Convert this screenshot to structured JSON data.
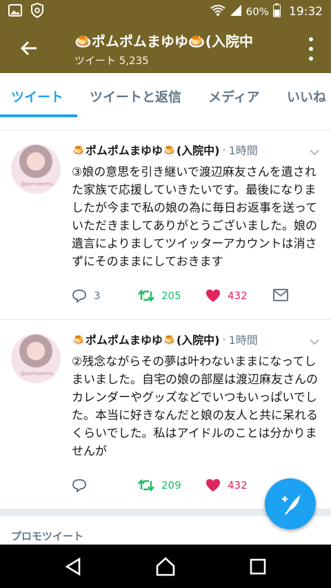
{
  "status_bar": {
    "battery": "60%",
    "time": "19:32",
    "icons": [
      "image-icon",
      "shield-icon",
      "wifi-icon",
      "signal-icon",
      "battery-icon"
    ]
  },
  "header": {
    "title": "🍮ポムポムまゆゆ🍮(入院中",
    "subtitle": "ツイート 5,235"
  },
  "tabs": [
    {
      "label": "ツイート",
      "active": true
    },
    {
      "label": "ツイートと返信",
      "active": false
    },
    {
      "label": "メディア",
      "active": false
    },
    {
      "label": "いいね",
      "active": false
    }
  ],
  "tweets": [
    {
      "author": "🍮ポムポムまゆゆ🍮(入院中)",
      "time": "1時間",
      "avatar_tag": "@pomupomu...",
      "text": "③娘の意思を引き継いで渡辺麻友さんを遺された家族で応援していきたいです。最後になりましたが今まで私の娘の為に毎日お返事を送っていただきましてありがとうございました。娘の遺言によりましてツイッターアカウントは消さずにそのままにしておきます",
      "replies": "3",
      "retweets": "205",
      "likes": "432"
    },
    {
      "author": "🍮ポムポムまゆゆ🍮(入院中)",
      "time": "1時間",
      "avatar_tag": "@pomupomu...",
      "text": "②残念ながらその夢は叶わないままになってしまいました。自宅の娘の部屋は渡辺麻友さんのカレンダーやグッズなどでいつもいっぱいでした。本当に好きなんだと娘の友人と共に呆れるくらいでした。私はアイドルのことは分かりませんが",
      "replies": "",
      "retweets": "209",
      "likes": "432"
    }
  ],
  "promo": {
    "label": "プロモツイート"
  },
  "colors": {
    "header_bg": "#756428",
    "accent": "#1da1f2",
    "retweet": "#17bf63",
    "like": "#e0245e",
    "muted": "#657786"
  }
}
